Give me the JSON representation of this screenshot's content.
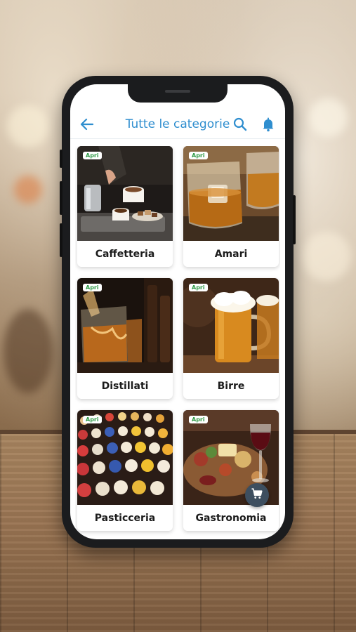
{
  "header": {
    "title": "Tutte le categorie",
    "back_icon": "arrow-left-icon",
    "search_icon": "search-icon",
    "notification_icon": "bell-icon"
  },
  "categories": [
    {
      "name": "Caffetteria",
      "badge": "Apri"
    },
    {
      "name": "Amari",
      "badge": "Apri"
    },
    {
      "name": "Distillati",
      "badge": "Apri"
    },
    {
      "name": "Birre",
      "badge": "Apri"
    },
    {
      "name": "Pasticceria",
      "badge": "Apri"
    },
    {
      "name": "Gastronomia",
      "badge": "Apri"
    }
  ],
  "cart": {
    "icon": "cart-icon"
  },
  "colors": {
    "accent": "#2f8ecf",
    "badge_text": "#2e9a45",
    "fab": "#3d4e5f"
  }
}
